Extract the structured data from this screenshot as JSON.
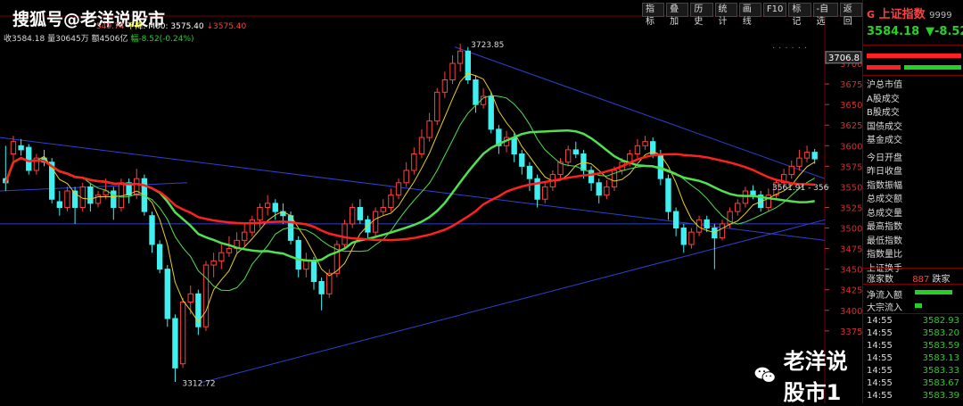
{
  "watermark_top": "搜狐号@老洋说股市",
  "watermark_bottom": "老洋说股市1",
  "toolbar": [
    "指标",
    "叠加",
    "历史",
    "统计",
    "画线",
    "F10",
    "标记",
    "-自选",
    "返回"
  ],
  "info_line_1": [
    {
      "text": "549.74",
      "color": "#ff4040"
    },
    {
      "text": "下降:",
      "color": "#ffff00"
    },
    {
      "text": "M60: 3575.40",
      "color": "#ffffff"
    },
    {
      "text": "↓3575.40",
      "color": "#ff4040"
    }
  ],
  "info_line_2": {
    "close": "收3584.18",
    "volume": "量30645万",
    "amount": "额4506亿",
    "change": "幅-8.52(-0.24%)"
  },
  "annotations": {
    "high": "3723.85",
    "low": "3312.72",
    "mid": "3561.91 - 356",
    "label_3706": "3706.8"
  },
  "y_axis": [
    "3700",
    "3675",
    "3650",
    "3625",
    "3600",
    "3575",
    "3550",
    "3525",
    "3500",
    "3475",
    "3450",
    "3425",
    "3400",
    "3375"
  ],
  "right_panel": {
    "title": "上证指数",
    "code": "9999",
    "tab_icon": "G",
    "price": "3584.18",
    "change": "▼-8.52",
    "labels": [
      "沪总市值",
      "A股成交",
      "B股成交",
      "国债成交",
      "基金成交",
      "今日开盘",
      "昨日收盘",
      "指数振幅",
      "总成交额",
      "总成交量",
      "最高指数",
      "最低指数",
      "指数量比",
      "上证换手"
    ],
    "up_down_label": "涨家数",
    "up_down_value": "887",
    "up_down_tail": "跌家",
    "flows": [
      "净流入额",
      "大宗流入"
    ],
    "ticks": [
      {
        "time": "14:55",
        "price": "3582.93"
      },
      {
        "time": "14:55",
        "price": "3583.20"
      },
      {
        "time": "14:55",
        "price": "3583.59"
      },
      {
        "time": "14:55",
        "price": "3583.13"
      },
      {
        "time": "14:55",
        "price": "3583.33"
      },
      {
        "time": "14:55",
        "price": "3583.67"
      },
      {
        "time": "14:55",
        "price": "3583.39"
      }
    ]
  },
  "colors": {
    "up": "#ff4040",
    "down": "#40f0f0",
    "ma_green": "#50e050",
    "ma_red": "#ff2020",
    "trend": "#3040d0",
    "accent_green": "#26d126"
  },
  "chart_data": {
    "type": "candlestick",
    "symbol": "上证指数",
    "ylim": [
      3300,
      3725
    ],
    "y_ticks": [
      3700,
      3675,
      3650,
      3625,
      3600,
      3575,
      3550,
      3525,
      3500,
      3475,
      3450,
      3425,
      3400,
      3375
    ],
    "high": 3723.85,
    "low": 3312.72,
    "ma60": 3575.4,
    "last_close": 3584.18,
    "candles": [
      [
        3560,
        3555,
        3600,
        3545
      ],
      [
        3590,
        3605,
        3612,
        3582
      ],
      [
        3600,
        3595,
        3608,
        3588
      ],
      [
        3598,
        3570,
        3602,
        3565
      ],
      [
        3570,
        3585,
        3590,
        3565
      ],
      [
        3585,
        3580,
        3595,
        3575
      ],
      [
        3580,
        3535,
        3585,
        3530
      ],
      [
        3532,
        3525,
        3545,
        3515
      ],
      [
        3525,
        3545,
        3550,
        3520
      ],
      [
        3545,
        3525,
        3550,
        3505
      ],
      [
        3525,
        3550,
        3555,
        3520
      ],
      [
        3550,
        3530,
        3555,
        3520
      ],
      [
        3530,
        3540,
        3545,
        3525
      ],
      [
        3540,
        3545,
        3560,
        3535
      ],
      [
        3545,
        3525,
        3550,
        3510
      ],
      [
        3525,
        3555,
        3560,
        3520
      ],
      [
        3555,
        3540,
        3560,
        3530
      ],
      [
        3540,
        3560,
        3572,
        3535
      ],
      [
        3560,
        3520,
        3565,
        3515
      ],
      [
        3515,
        3480,
        3520,
        3470
      ],
      [
        3480,
        3450,
        3485,
        3445
      ],
      [
        3450,
        3390,
        3455,
        3380
      ],
      [
        3390,
        3330,
        3395,
        3313
      ],
      [
        3335,
        3410,
        3415,
        3330
      ],
      [
        3410,
        3420,
        3430,
        3395
      ],
      [
        3420,
        3380,
        3425,
        3370
      ],
      [
        3380,
        3455,
        3460,
        3375
      ],
      [
        3455,
        3460,
        3470,
        3440
      ],
      [
        3460,
        3470,
        3480,
        3450
      ],
      [
        3470,
        3475,
        3490,
        3465
      ],
      [
        3475,
        3485,
        3495,
        3470
      ],
      [
        3485,
        3495,
        3505,
        3478
      ],
      [
        3495,
        3510,
        3515,
        3490
      ],
      [
        3510,
        3525,
        3530,
        3500
      ],
      [
        3525,
        3530,
        3540,
        3515
      ],
      [
        3530,
        3520,
        3535,
        3510
      ],
      [
        3520,
        3515,
        3530,
        3505
      ],
      [
        3515,
        3485,
        3520,
        3480
      ],
      [
        3485,
        3450,
        3490,
        3440
      ],
      [
        3450,
        3460,
        3470,
        3440
      ],
      [
        3460,
        3435,
        3465,
        3425
      ],
      [
        3435,
        3420,
        3440,
        3400
      ],
      [
        3420,
        3445,
        3450,
        3415
      ],
      [
        3445,
        3480,
        3485,
        3440
      ],
      [
        3480,
        3505,
        3510,
        3475
      ],
      [
        3505,
        3525,
        3530,
        3500
      ],
      [
        3525,
        3510,
        3535,
        3505
      ],
      [
        3510,
        3495,
        3515,
        3488
      ],
      [
        3495,
        3520,
        3525,
        3490
      ],
      [
        3520,
        3525,
        3535,
        3515
      ],
      [
        3525,
        3540,
        3548,
        3520
      ],
      [
        3540,
        3555,
        3560,
        3535
      ],
      [
        3555,
        3570,
        3580,
        3550
      ],
      [
        3570,
        3590,
        3598,
        3565
      ],
      [
        3590,
        3610,
        3620,
        3585
      ],
      [
        3610,
        3630,
        3640,
        3605
      ],
      [
        3630,
        3665,
        3670,
        3625
      ],
      [
        3665,
        3680,
        3690,
        3658
      ],
      [
        3680,
        3700,
        3710,
        3675
      ],
      [
        3700,
        3715,
        3724,
        3690
      ],
      [
        3715,
        3680,
        3720,
        3675
      ],
      [
        3680,
        3650,
        3685,
        3640
      ],
      [
        3650,
        3660,
        3670,
        3645
      ],
      [
        3660,
        3620,
        3665,
        3615
      ],
      [
        3620,
        3600,
        3625,
        3590
      ],
      [
        3600,
        3610,
        3618,
        3592
      ],
      [
        3610,
        3590,
        3615,
        3580
      ],
      [
        3590,
        3575,
        3595,
        3565
      ],
      [
        3575,
        3560,
        3580,
        3545
      ],
      [
        3560,
        3535,
        3565,
        3525
      ],
      [
        3535,
        3550,
        3555,
        3530
      ],
      [
        3550,
        3565,
        3570,
        3545
      ],
      [
        3565,
        3580,
        3585,
        3560
      ],
      [
        3580,
        3595,
        3600,
        3575
      ],
      [
        3595,
        3590,
        3605,
        3585
      ],
      [
        3590,
        3570,
        3595,
        3560
      ],
      [
        3570,
        3555,
        3575,
        3545
      ],
      [
        3555,
        3540,
        3560,
        3530
      ],
      [
        3540,
        3550,
        3558,
        3535
      ],
      [
        3550,
        3570,
        3575,
        3545
      ],
      [
        3570,
        3580,
        3585,
        3565
      ],
      [
        3580,
        3590,
        3595,
        3575
      ],
      [
        3590,
        3600,
        3608,
        3585
      ],
      [
        3600,
        3605,
        3612,
        3595
      ],
      [
        3605,
        3590,
        3610,
        3585
      ],
      [
        3590,
        3560,
        3595,
        3552
      ],
      [
        3560,
        3520,
        3565,
        3510
      ],
      [
        3520,
        3500,
        3525,
        3490
      ],
      [
        3500,
        3480,
        3505,
        3470
      ],
      [
        3480,
        3495,
        3500,
        3475
      ],
      [
        3495,
        3510,
        3515,
        3490
      ],
      [
        3510,
        3500,
        3515,
        3495
      ],
      [
        3500,
        3488,
        3505,
        3450
      ],
      [
        3488,
        3505,
        3510,
        3485
      ],
      [
        3505,
        3520,
        3525,
        3500
      ],
      [
        3520,
        3530,
        3535,
        3515
      ],
      [
        3530,
        3545,
        3550,
        3525
      ],
      [
        3545,
        3540,
        3552,
        3535
      ],
      [
        3540,
        3525,
        3545,
        3520
      ],
      [
        3525,
        3540,
        3548,
        3520
      ],
      [
        3540,
        3555,
        3560,
        3535
      ],
      [
        3555,
        3565,
        3572,
        3550
      ],
      [
        3565,
        3575,
        3582,
        3560
      ],
      [
        3575,
        3585,
        3595,
        3570
      ],
      [
        3585,
        3592,
        3600,
        3580
      ],
      [
        3592,
        3584,
        3596,
        3578
      ]
    ]
  }
}
